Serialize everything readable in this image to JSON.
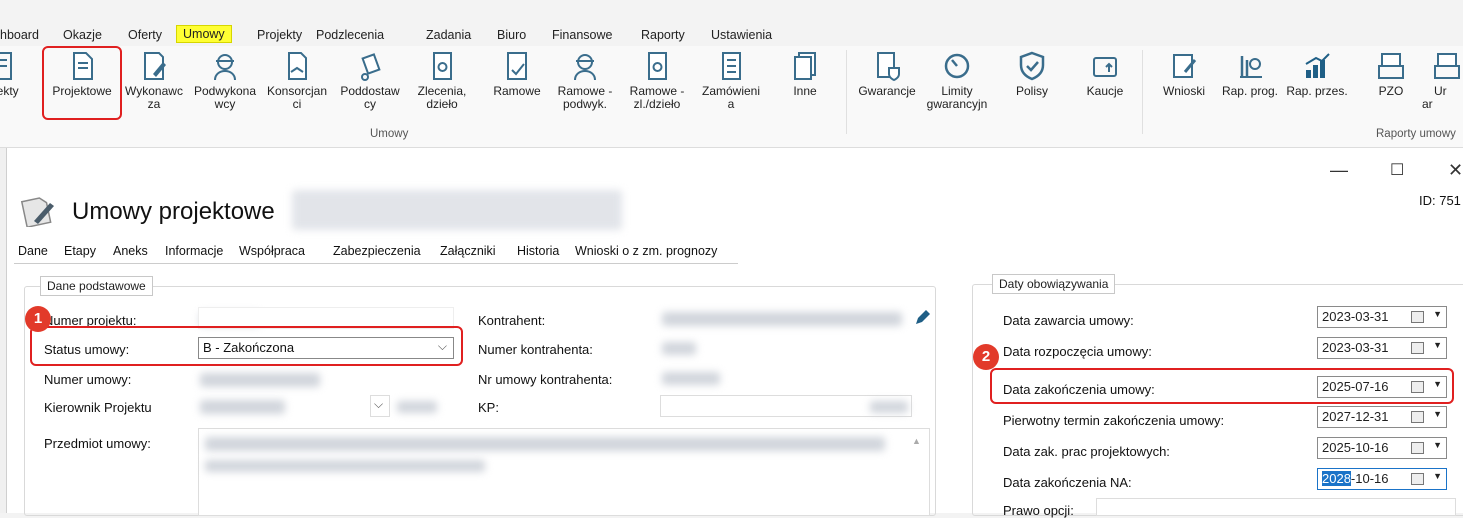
{
  "menu": {
    "items": [
      "hboard",
      "Okazje",
      "Oferty",
      "Umowy",
      "Projekty",
      "Podzlecenia",
      "Zadania",
      "Biuro",
      "Finansowe",
      "Raporty",
      "Ustawienia"
    ],
    "active": "Umowy",
    "highlight_color": "#ffff33"
  },
  "ribbon": {
    "buttons": [
      {
        "label": "rojekty",
        "icon": "projects-icon"
      },
      {
        "label": "Projektowe",
        "icon": "document-icon"
      },
      {
        "label": "Wykonawc\nza",
        "icon": "edit-doc-icon"
      },
      {
        "label": "Podwykona\nwcy",
        "icon": "worker-icon"
      },
      {
        "label": "Konsorcjan\nci",
        "icon": "handshake-icon"
      },
      {
        "label": "Poddostaw\ncy",
        "icon": "dolly-icon"
      },
      {
        "label": "Zlecenia,\ndzieło",
        "icon": "order-icon"
      },
      {
        "label": "Ramowe",
        "icon": "frame-doc-icon"
      },
      {
        "label": "Ramowe -\npodwyk.",
        "icon": "worker-icon"
      },
      {
        "label": "Ramowe -\nzl./dzieło",
        "icon": "order-icon"
      },
      {
        "label": "Zamówieni\na",
        "icon": "list-icon"
      },
      {
        "label": "Inne",
        "icon": "stack-icon"
      },
      {
        "label": "Gwarancje",
        "icon": "guarantee-icon"
      },
      {
        "label": "Limity\ngwarancyjn",
        "icon": "gauge-icon"
      },
      {
        "label": "Polisy",
        "icon": "shield-icon"
      },
      {
        "label": "Kaucje",
        "icon": "deposit-icon"
      },
      {
        "label": "Wnioski",
        "icon": "request-icon"
      },
      {
        "label": "Rap. prog.",
        "icon": "report-icon"
      },
      {
        "label": "Rap. przes.",
        "icon": "chart-up-icon"
      },
      {
        "label": "PZO",
        "icon": "tray-icon"
      },
      {
        "label": "Ur\nar",
        "icon": "tray-icon"
      }
    ],
    "group_umowy": "Umowy",
    "group_raporty": "Raporty umowy",
    "selected": "Projektowe"
  },
  "dialog": {
    "title": "Umowy projektowe",
    "id_label": "ID: 751",
    "tabs": [
      "Dane",
      "Etapy",
      "Aneks",
      "Informacje",
      "Współpraca",
      "Zabezpieczenia",
      "Załączniki",
      "Historia",
      "Wnioski o z zm. prognozy"
    ],
    "active_tab": "Dane"
  },
  "basic": {
    "legend": "Dane podstawowe",
    "numer_projektu": "Numer projektu:",
    "status_umowy": "Status umowy:",
    "status_value": "B - Zakończona",
    "numer_umowy": "Numer umowy:",
    "kierownik": "Kierownik Projektu",
    "przedmiot": "Przedmiot umowy:",
    "kontrahent": "Kontrahent:",
    "numer_kontrahenta": "Numer kontrahenta:",
    "nr_umowy_kontrahenta": "Nr umowy kontrahenta:",
    "kp": "KP:"
  },
  "dates": {
    "legend": "Daty obowiązywania",
    "rows": [
      {
        "label": "Data zawarcia umowy:",
        "value": "2023-03-31"
      },
      {
        "label": "Data rozpoczęcia umowy:",
        "value": "2023-03-31"
      },
      {
        "label": "Data zakończenia umowy:",
        "value": "2025-07-16"
      },
      {
        "label": "Pierwotny termin zakończenia umowy:",
        "value": "2027-12-31"
      },
      {
        "label": "Data zak. prac projektowych:",
        "value": "2025-10-16"
      },
      {
        "label": "Data zakończenia NA:",
        "value": "2028-10-16",
        "selected_part": "2028",
        "rest": "-10-16"
      }
    ],
    "prawo_opcji": "Prawo opcji:"
  },
  "annotations": {
    "badge1": "1",
    "badge2": "2",
    "color": "#e02020"
  },
  "window": {
    "minimize": "—",
    "maximize": "☐",
    "close": "✕"
  }
}
